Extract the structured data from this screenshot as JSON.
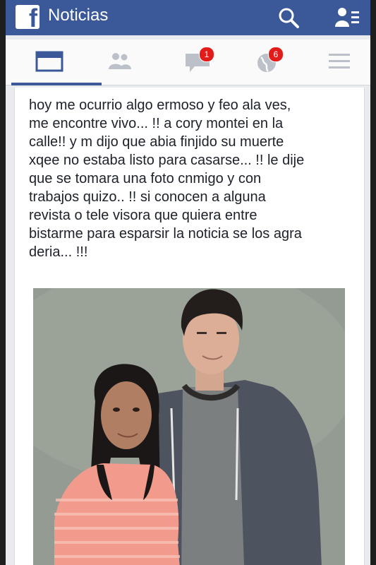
{
  "header": {
    "logo_letter": "f",
    "title": "Noticias",
    "icons": [
      "facebook-logo-icon",
      "search-icon",
      "friend-requests-icon"
    ]
  },
  "nav": {
    "tabs": [
      {
        "name": "news-feed",
        "icon": "news-feed-icon",
        "active": true
      },
      {
        "name": "friends",
        "icon": "friends-icon",
        "active": false
      },
      {
        "name": "messages",
        "icon": "chat-bubble-icon",
        "badge": "1"
      },
      {
        "name": "notifications",
        "icon": "globe-icon",
        "badge": "6"
      },
      {
        "name": "menu",
        "icon": "hamburger-menu-icon",
        "active": false
      }
    ]
  },
  "post": {
    "text": "hoy me ocurrio algo ermoso y feo ala ves,\nme encontre vivo... !! a cory montei en la\ncalle!! y m dijo que abia finjido su muerte\nxqee no estaba listo para casarse... !! le dije\nque se tomara una foto cnmigo y con\ntrabajos quizo.. !!  si conocen a alguna\nrevista o tele visora que quiera entre\nbistarme para esparsir la noticia se los agra\nderia... !!!"
  },
  "colors": {
    "brand": "#3b5998",
    "badge": "#e21b1b",
    "background": "#e9ebee"
  }
}
